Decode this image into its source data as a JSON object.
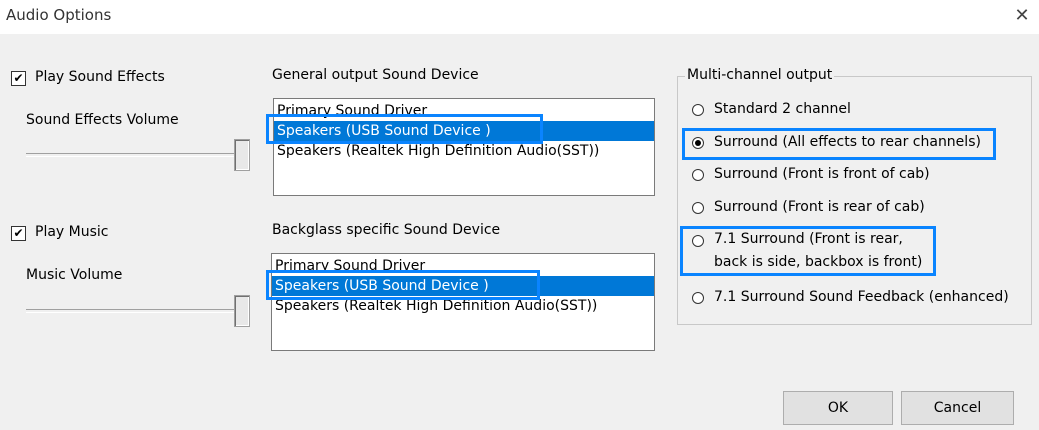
{
  "window": {
    "title": "Audio Options",
    "close_glyph": "✕"
  },
  "sound_effects": {
    "checkbox_label": "Play Sound Effects",
    "checked_glyph": "✔",
    "volume_label": "Sound Effects Volume"
  },
  "music": {
    "checkbox_label": "Play Music",
    "checked_glyph": "✔",
    "volume_label": "Music Volume"
  },
  "general_output": {
    "label": "General output Sound Device",
    "items": [
      "Primary Sound Driver",
      "Speakers (USB Sound Device        )",
      "Speakers (Realtek High Definition Audio(SST))"
    ],
    "selected_index": 1
  },
  "backglass_output": {
    "label": "Backglass specific Sound Device",
    "items": [
      "Primary Sound Driver",
      "Speakers (USB Sound Device        )",
      "Speakers (Realtek High Definition Audio(SST))"
    ],
    "selected_index": 1
  },
  "multichannel": {
    "legend": "Multi-channel output",
    "options": [
      {
        "label": "Standard 2 channel"
      },
      {
        "label": "Surround (All effects to rear channels)"
      },
      {
        "label": "Surround (Front is front of cab)"
      },
      {
        "label": "Surround (Front is rear of cab)"
      },
      {
        "label_line1": "7.1 Surround (Front is rear,",
        "label_line2": "back is side, backbox is front)"
      },
      {
        "label": "7.1 Surround Sound Feedback (enhanced)"
      }
    ],
    "selected_index": 1
  },
  "buttons": {
    "ok": "OK",
    "cancel": "Cancel"
  },
  "colors": {
    "selection": "#0078d7",
    "highlight_box": "#0a84ff"
  }
}
